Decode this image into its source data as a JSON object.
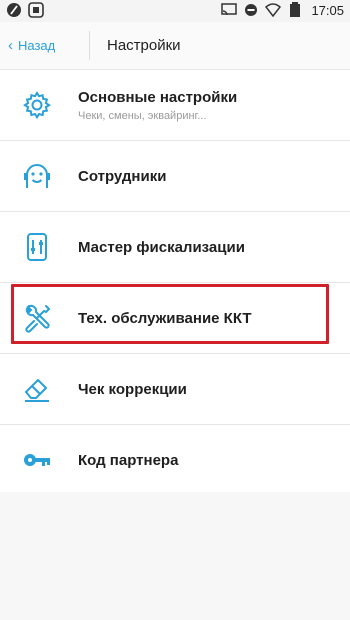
{
  "status_bar": {
    "time": "17:05",
    "left_icons": [
      "slash-app-icon",
      "square-app-icon"
    ],
    "right_icons": [
      "cast-icon",
      "do-not-disturb-icon",
      "wifi-icon",
      "battery-icon"
    ]
  },
  "toolbar": {
    "back_chevron": "‹",
    "back_label": "Назад",
    "title": "Настройки"
  },
  "menu": {
    "items": [
      {
        "label": "Основные настройки",
        "sub": "Чеки, смены, эквайринг...",
        "icon": "gear-icon"
      },
      {
        "label": "Сотрудники",
        "sub": "",
        "icon": "person-face-icon"
      },
      {
        "label": "Мастер фискализации",
        "sub": "",
        "icon": "fiscal-device-icon"
      },
      {
        "label": "Тех. обслуживание ККТ",
        "sub": "",
        "icon": "tools-icon"
      },
      {
        "label": "Чек коррекции",
        "sub": "",
        "icon": "eraser-icon"
      },
      {
        "label": "Код партнера",
        "sub": "",
        "icon": "key-icon"
      }
    ]
  },
  "colors": {
    "accent": "#2aa0d8",
    "highlight": "#d0202a",
    "text": "#1f1f1f"
  }
}
